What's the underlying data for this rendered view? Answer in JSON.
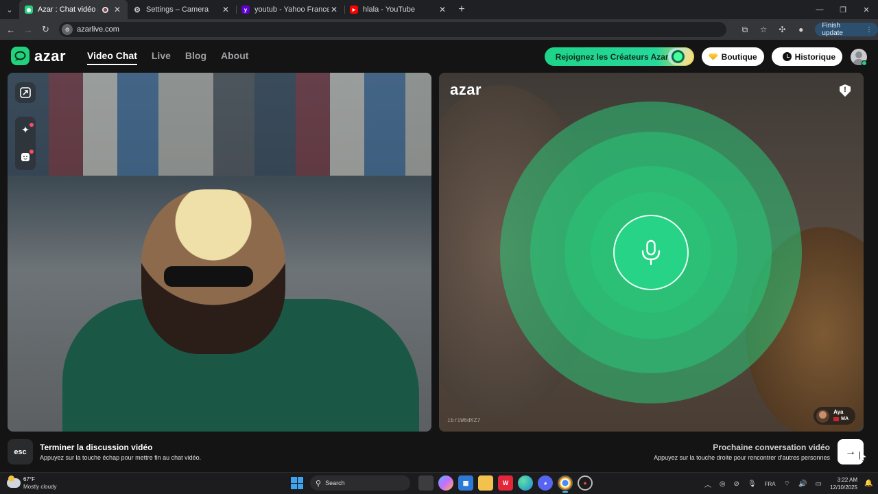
{
  "browser": {
    "tabs": [
      {
        "title": "Azar : Chat vidéo avec de n",
        "favicon_color": "#22d17b",
        "active": true
      },
      {
        "title": "Settings – Camera",
        "favicon_color": "#9aa0a6",
        "active": false
      },
      {
        "title": "youtub - Yahoo France Résultat",
        "favicon_color": "#6001d2",
        "active": false
      },
      {
        "title": "hlala - YouTube",
        "favicon_color": "#ff0000",
        "active": false
      }
    ],
    "url": "azarlive.com",
    "finish_update_label": "Finish update"
  },
  "header": {
    "logo_text": "azar",
    "nav": [
      {
        "label": "Video Chat",
        "active": true
      },
      {
        "label": "Live",
        "active": false
      },
      {
        "label": "Blog",
        "active": false
      },
      {
        "label": "About",
        "active": false
      }
    ],
    "creators_label": "Rejoignez les Créateurs Azar",
    "shop_label": "Boutique",
    "history_label": "Historique",
    "accent_color": "#22d17b"
  },
  "remote": {
    "watermark": "azar",
    "peer_id": "ibriW6dKZ7",
    "peer_name": "Aya",
    "peer_country": "MA"
  },
  "bottom": {
    "esc_key": "esc",
    "end_title": "Terminer la discussion vidéo",
    "end_subtitle": "Appuyez sur la touche échap pour mettre fin au chat vidéo.",
    "next_title": "Prochaine conversation vidéo",
    "next_subtitle": "Appuyez sur la touche droite pour rencontrer d'autres personnes"
  },
  "taskbar": {
    "temperature": "67°F",
    "weather": "Mostly cloudy",
    "search_placeholder": "Search",
    "language": "FRA",
    "time": "3:22 AM",
    "date": "12/10/2025"
  }
}
